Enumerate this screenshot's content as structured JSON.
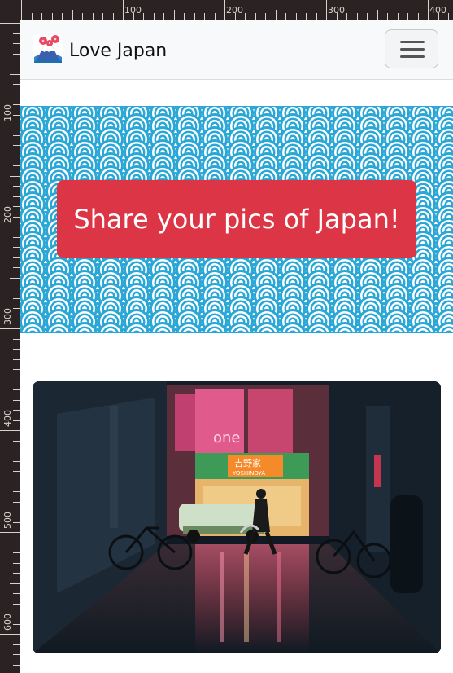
{
  "ruler": {
    "top_labels": [
      "100",
      "200",
      "300",
      "400"
    ],
    "left_labels": [
      "100",
      "200",
      "300",
      "400",
      "500",
      "600"
    ]
  },
  "navbar": {
    "brand_name": "Love Japan",
    "brand_icon": "mount-fuji-icon",
    "menu_icon": "hamburger-menu-icon"
  },
  "hero": {
    "pattern": "seigaiha-wave",
    "button_label": "Share your pics of Japan!"
  },
  "photo": {
    "subject": "rainy Tokyo alley at night",
    "sign_text": "吉野家",
    "sign_subtext": "YOSHINOYA",
    "neon_text": "one"
  },
  "colors": {
    "navbar_bg": "#f8f9fa",
    "button_bg": "#dc3545",
    "wave_blue": "#2aa7d6"
  }
}
